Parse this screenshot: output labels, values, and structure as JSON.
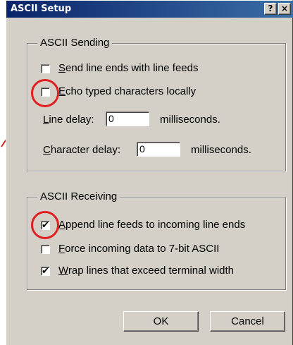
{
  "window": {
    "title": "ASCII Setup",
    "help_glyph": "?",
    "close_glyph": "×"
  },
  "sending": {
    "legend": "ASCII Sending",
    "send_line_ends": {
      "mnemonic": "S",
      "rest": "end line ends with line feeds",
      "checked": false
    },
    "echo_typed": {
      "mnemonic": "E",
      "rest": "cho typed characters locally",
      "checked": false
    },
    "line_delay": {
      "mnemonic": "L",
      "rest": "ine delay:",
      "value": "0",
      "unit": "milliseconds."
    },
    "char_delay": {
      "mnemonic": "C",
      "rest": "haracter delay:",
      "value": "0",
      "unit": "milliseconds."
    }
  },
  "receiving": {
    "legend": "ASCII Receiving",
    "append_line_feeds": {
      "mnemonic": "A",
      "rest": "ppend line feeds to incoming line ends",
      "checked": true
    },
    "force_7bit": {
      "mnemonic": "F",
      "rest": "orce incoming data to 7-bit ASCII",
      "checked": false
    },
    "wrap_lines": {
      "mnemonic": "W",
      "rest": "rap lines that exceed terminal width",
      "checked": true
    }
  },
  "buttons": {
    "ok": "OK",
    "cancel": "Cancel"
  },
  "check_glyph": "✔",
  "colors": {
    "annotation": "#e02020",
    "titlebar": "#0a246a",
    "face": "#d4d0c8"
  }
}
